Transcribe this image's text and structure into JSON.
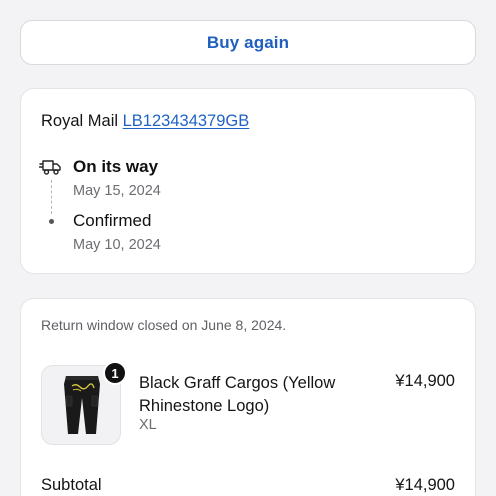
{
  "actions": {
    "buy_again_label": "Buy again"
  },
  "shipping": {
    "carrier": "Royal Mail",
    "tracking_number": "LB123434379GB",
    "events": [
      {
        "title": "On its way",
        "date": "May 15, 2024",
        "icon": "truck-icon"
      },
      {
        "title": "Confirmed",
        "date": "May 10, 2024"
      }
    ]
  },
  "order": {
    "return_window_text": "Return window closed on June 8, 2024.",
    "items": [
      {
        "quantity": "1",
        "name": "Black Graff Cargos (Yellow Rhinestone Logo)",
        "variant": "XL",
        "price": "¥14,900",
        "image_icon": "black-cargo-pants-image"
      }
    ],
    "subtotal_label": "Subtotal",
    "subtotal_value": "¥14,900"
  },
  "colors": {
    "accent": "#1f5fbf",
    "link": "#1f63c6",
    "muted_text": "#6d6d72",
    "background": "#f3f3f5"
  }
}
